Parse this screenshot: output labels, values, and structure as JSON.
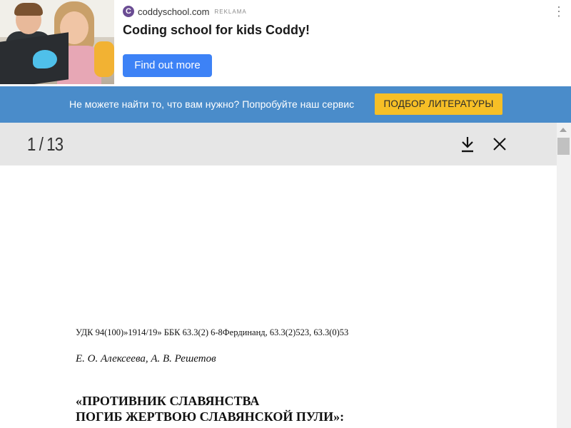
{
  "ad": {
    "brand_icon": "C",
    "domain": "coddyschool.com",
    "tag": "REKLAMA",
    "title": "Coding school for kids Coddy!",
    "button_label": "Find out more",
    "menu_icon": "⋮",
    "image_icon": "kids-with-laptop-photo",
    "accent_color": "#3d82f6"
  },
  "service": {
    "text": "Не можете найти то, что вам нужно? Попробуйте наш сервис",
    "button_label": "ПОДБОР ЛИТЕРАТУРЫ",
    "bar_color": "#4a8cca",
    "button_color": "#f6bf26"
  },
  "viewer": {
    "page_counter": "1 / 13",
    "download_icon": "download-icon",
    "close_icon": "close-icon"
  },
  "document": {
    "udc_line": "УДК 94(100)»1914/19»   ББК 63.3(2) 6-8Фердинанд, 63.3(2)523, 63.3(0)53",
    "authors": "Е. О. Алексеева, А. В. Решетов",
    "title_line1": "«ПРОТИВНИК СЛАВЯНСТВА",
    "title_line2": "ПОГИБ ЖЕРТВОЮ СЛАВЯНСКОЙ ПУЛИ»:"
  }
}
